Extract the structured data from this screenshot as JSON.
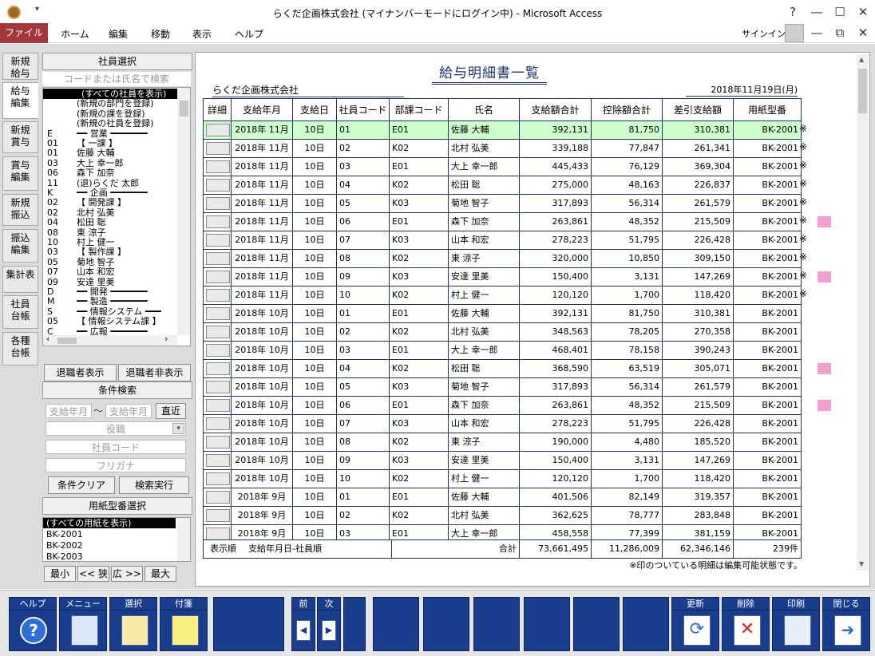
{
  "window": {
    "title": "らくだ企画株式会社 (マイナンバーモードにログイン中) - Microsoft Access",
    "qat": "▾",
    "help": "?",
    "minimize": "—",
    "maximize": "☐",
    "close": "✕"
  },
  "menu": {
    "file": "ファイル",
    "tabs": [
      "ホーム",
      "編集",
      "移動",
      "表示",
      "ヘルプ"
    ],
    "signin": "サインイン",
    "min": "—",
    "restore": "⧉",
    "close": "✕"
  },
  "vtabs": [
    {
      "line1": "新規",
      "line2": "給与"
    },
    {
      "line1": "給与",
      "line2": "編集"
    },
    {
      "line1": "新規",
      "line2": "賞与"
    },
    {
      "line1": "賞与",
      "line2": "編集"
    },
    {
      "line1": "新規",
      "line2": "振込"
    },
    {
      "line1": "振込",
      "line2": "編集"
    },
    {
      "line1": "集計表",
      "line2": ""
    },
    {
      "line1": "社員",
      "line2": "台帳"
    },
    {
      "line1": "各種",
      "line2": "台帳"
    }
  ],
  "left": {
    "emp_header": "社員選択",
    "search_placeholder": "コードまたは氏名で検索",
    "tree": [
      {
        "c": "",
        "t": "(すべての社員を表示)",
        "sel": true
      },
      {
        "c": "",
        "t": "(新規の部門を登録)"
      },
      {
        "c": "",
        "t": "(新規の課を登録)"
      },
      {
        "c": "",
        "t": "(新規の社員を登録)"
      },
      {
        "c": "E",
        "t": "━━ 営業 ━━━━━━━"
      },
      {
        "c": "01",
        "t": "【 一課 】"
      },
      {
        "c": "01",
        "t": "  佐藤 大輔"
      },
      {
        "c": "03",
        "t": "  大上 幸一郎"
      },
      {
        "c": "06",
        "t": "  森下 加奈"
      },
      {
        "c": "11",
        "t": "(退)らくだ 太郎"
      },
      {
        "c": "K",
        "t": "━━ 企画 ━━━━━━━"
      },
      {
        "c": "02",
        "t": "【 開発課 】"
      },
      {
        "c": "02",
        "t": "  北村 弘美"
      },
      {
        "c": "04",
        "t": "  松田 聡"
      },
      {
        "c": "08",
        "t": "  東 涼子"
      },
      {
        "c": "10",
        "t": "  村上 健一"
      },
      {
        "c": "03",
        "t": "【 製作課 】"
      },
      {
        "c": "05",
        "t": "  菊地 智子"
      },
      {
        "c": "07",
        "t": "  山本 和宏"
      },
      {
        "c": "09",
        "t": "  安達 里美"
      },
      {
        "c": "D",
        "t": "━━ 開発 ━━━━━━━"
      },
      {
        "c": "M",
        "t": "━━ 製造 ━━━━━━━"
      },
      {
        "c": "S",
        "t": "━━ 情報システム ━━━"
      },
      {
        "c": "05",
        "t": "【 情報システム課 】"
      },
      {
        "c": "C",
        "t": "━━ 広報 ━━━━━━━"
      }
    ],
    "show_retired": "退職者表示",
    "hide_retired": "退職者非表示",
    "cond_header": "条件検索",
    "from_ph": "支給年月",
    "tilde": "～",
    "to_ph": "支給年月",
    "recent": "直近",
    "role_ph": "役職",
    "code_ph": "社員コード",
    "kana_ph": "フリガナ",
    "clear": "条件クリア",
    "exec": "検索実行",
    "paper_header": "用紙型番選択",
    "papers": [
      "(すべての用紙を表示)",
      "BK-2001",
      "BK-2002",
      "BK-2003"
    ],
    "nav": [
      "最小",
      "<< 狭",
      "広 >>",
      "最大"
    ]
  },
  "report": {
    "title": "給与明細書一覧",
    "company": "らくだ企画株式会社",
    "date": "2018年11月19日(月)",
    "headers": [
      "詳細",
      "支給年月",
      "支給日",
      "社員コード",
      "部課コード",
      "氏名",
      "支給額合計",
      "控除額合計",
      "差引支給額",
      "用紙型番"
    ],
    "rows": [
      {
        "ym": "2018年 11月",
        "day": "10日",
        "code": "01",
        "dept": "E01",
        "name": "佐藤 大輔",
        "pay": "392,131",
        "ded": "81,750",
        "net": "310,381",
        "paper": "BK-2001",
        "mark": "※",
        "pink": false
      },
      {
        "ym": "2018年 11月",
        "day": "10日",
        "code": "02",
        "dept": "K02",
        "name": "北村 弘美",
        "pay": "339,188",
        "ded": "77,847",
        "net": "261,341",
        "paper": "BK-2001",
        "mark": "※",
        "pink": false
      },
      {
        "ym": "2018年 11月",
        "day": "10日",
        "code": "03",
        "dept": "E01",
        "name": "大上 幸一郎",
        "pay": "445,433",
        "ded": "76,129",
        "net": "369,304",
        "paper": "BK-2001",
        "mark": "※",
        "pink": false
      },
      {
        "ym": "2018年 11月",
        "day": "10日",
        "code": "04",
        "dept": "K02",
        "name": "松田 聡",
        "pay": "275,000",
        "ded": "48,163",
        "net": "226,837",
        "paper": "BK-2001",
        "mark": "※",
        "pink": false
      },
      {
        "ym": "2018年 11月",
        "day": "10日",
        "code": "05",
        "dept": "K03",
        "name": "菊地 智子",
        "pay": "317,893",
        "ded": "56,314",
        "net": "261,579",
        "paper": "BK-2001",
        "mark": "※",
        "pink": false
      },
      {
        "ym": "2018年 11月",
        "day": "10日",
        "code": "06",
        "dept": "E01",
        "name": "森下 加奈",
        "pay": "263,861",
        "ded": "48,352",
        "net": "215,509",
        "paper": "BK-2001",
        "mark": "※",
        "pink": true
      },
      {
        "ym": "2018年 11月",
        "day": "10日",
        "code": "07",
        "dept": "K03",
        "name": "山本 和宏",
        "pay": "278,223",
        "ded": "51,795",
        "net": "226,428",
        "paper": "BK-2001",
        "mark": "※",
        "pink": false
      },
      {
        "ym": "2018年 11月",
        "day": "10日",
        "code": "08",
        "dept": "K02",
        "name": "東 涼子",
        "pay": "320,000",
        "ded": "10,850",
        "net": "309,150",
        "paper": "BK-2001",
        "mark": "※",
        "pink": false
      },
      {
        "ym": "2018年 11月",
        "day": "10日",
        "code": "09",
        "dept": "K03",
        "name": "安達 里美",
        "pay": "150,400",
        "ded": "3,131",
        "net": "147,269",
        "paper": "BK-2001",
        "mark": "※",
        "pink": true
      },
      {
        "ym": "2018年 11月",
        "day": "10日",
        "code": "10",
        "dept": "K02",
        "name": "村上 健一",
        "pay": "120,120",
        "ded": "1,700",
        "net": "118,420",
        "paper": "BK-2001",
        "mark": "※",
        "pink": false
      },
      {
        "ym": "2018年 10月",
        "day": "10日",
        "code": "01",
        "dept": "E01",
        "name": "佐藤 大輔",
        "pay": "392,131",
        "ded": "81,750",
        "net": "310,381",
        "paper": "BK-2001",
        "mark": "",
        "pink": false
      },
      {
        "ym": "2018年 10月",
        "day": "10日",
        "code": "02",
        "dept": "K02",
        "name": "北村 弘美",
        "pay": "348,563",
        "ded": "78,205",
        "net": "270,358",
        "paper": "BK-2001",
        "mark": "",
        "pink": false
      },
      {
        "ym": "2018年 10月",
        "day": "10日",
        "code": "03",
        "dept": "E01",
        "name": "大上 幸一郎",
        "pay": "468,401",
        "ded": "78,158",
        "net": "390,243",
        "paper": "BK-2001",
        "mark": "",
        "pink": false
      },
      {
        "ym": "2018年 10月",
        "day": "10日",
        "code": "04",
        "dept": "K02",
        "name": "松田 聡",
        "pay": "368,590",
        "ded": "63,519",
        "net": "305,071",
        "paper": "BK-2001",
        "mark": "",
        "pink": true
      },
      {
        "ym": "2018年 10月",
        "day": "10日",
        "code": "05",
        "dept": "K03",
        "name": "菊地 智子",
        "pay": "317,893",
        "ded": "56,314",
        "net": "261,579",
        "paper": "BK-2001",
        "mark": "",
        "pink": false
      },
      {
        "ym": "2018年 10月",
        "day": "10日",
        "code": "06",
        "dept": "E01",
        "name": "森下 加奈",
        "pay": "263,861",
        "ded": "48,352",
        "net": "215,509",
        "paper": "BK-2001",
        "mark": "",
        "pink": true
      },
      {
        "ym": "2018年 10月",
        "day": "10日",
        "code": "07",
        "dept": "K03",
        "name": "山本 和宏",
        "pay": "278,223",
        "ded": "51,795",
        "net": "226,428",
        "paper": "BK-2001",
        "mark": "",
        "pink": false
      },
      {
        "ym": "2018年 10月",
        "day": "10日",
        "code": "08",
        "dept": "K02",
        "name": "東 涼子",
        "pay": "190,000",
        "ded": "4,480",
        "net": "185,520",
        "paper": "BK-2001",
        "mark": "",
        "pink": false
      },
      {
        "ym": "2018年 10月",
        "day": "10日",
        "code": "09",
        "dept": "K03",
        "name": "安達 里美",
        "pay": "150,400",
        "ded": "3,131",
        "net": "147,269",
        "paper": "BK-2001",
        "mark": "",
        "pink": false
      },
      {
        "ym": "2018年 10月",
        "day": "10日",
        "code": "10",
        "dept": "K02",
        "name": "村上 健一",
        "pay": "120,120",
        "ded": "1,700",
        "net": "118,420",
        "paper": "BK-2001",
        "mark": "",
        "pink": false
      },
      {
        "ym": "2018年 9月",
        "day": "10日",
        "code": "01",
        "dept": "E01",
        "name": "佐藤 大輔",
        "pay": "401,506",
        "ded": "82,149",
        "net": "319,357",
        "paper": "BK-2001",
        "mark": "",
        "pink": false
      },
      {
        "ym": "2018年 9月",
        "day": "10日",
        "code": "02",
        "dept": "K02",
        "name": "北村 弘美",
        "pay": "362,625",
        "ded": "78,777",
        "net": "283,848",
        "paper": "BK-2001",
        "mark": "",
        "pink": false
      },
      {
        "ym": "2018年 9月",
        "day": "10日",
        "code": "03",
        "dept": "E01",
        "name": "大上 幸一郎",
        "pay": "458,558",
        "ded": "77,399",
        "net": "381,159",
        "paper": "BK-2001",
        "mark": "",
        "pink": false
      }
    ],
    "footer": {
      "order_label": "表示順",
      "order_value": "支給年月日-社員順",
      "total_label": "合計",
      "pay_total": "73,661,495",
      "ded_total": "11,286,009",
      "net_total": "62,346,146",
      "count": "239件"
    },
    "note": "※印のついている明細は編集可能状態です。"
  },
  "bottom": {
    "help": "ヘルプ",
    "menu": "メニュー",
    "select": "選択",
    "tag": "付箋",
    "prev": "前",
    "next": "次",
    "refresh": "更新",
    "delete": "削除",
    "print": "印刷",
    "close": "閉じる"
  },
  "colors": {
    "file_tab": "#a4373a",
    "highlight_row": "#ccffcc",
    "editable_mark": "#f59fd0",
    "toolbar_blue": "#1a3c8c",
    "grid_line": "#203070"
  }
}
